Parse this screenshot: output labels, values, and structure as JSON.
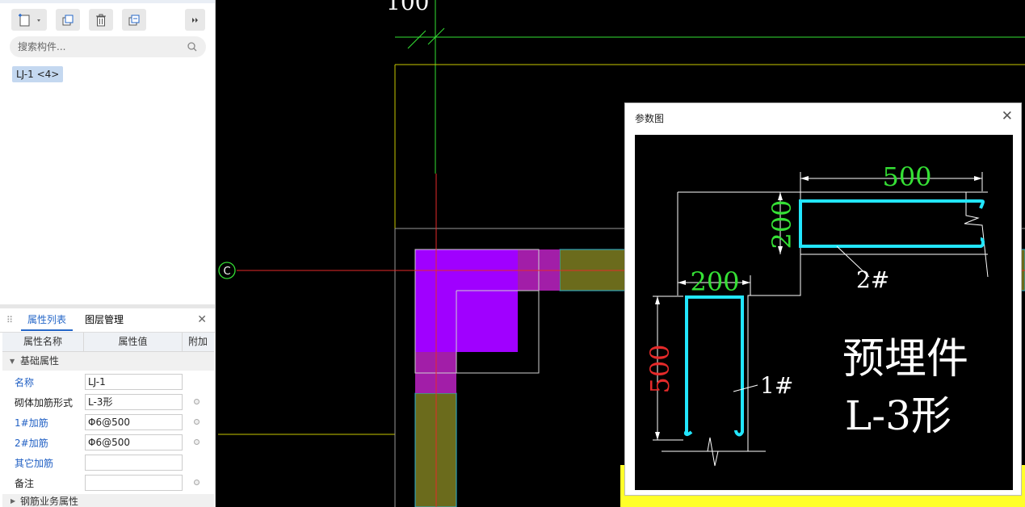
{
  "toolbar": {
    "buttons": [
      "new-component-icon",
      "copy-icon",
      "delete-icon",
      "duplicate-icon",
      "more-icon"
    ]
  },
  "search": {
    "placeholder": "搜索构件..."
  },
  "component_item": "LJ-1 <4>",
  "properties_panel": {
    "tabs": [
      "属性列表",
      "图层管理"
    ],
    "headers": [
      "属性名称",
      "属性值",
      "附加"
    ],
    "group": "基础属性",
    "rows": [
      {
        "name": "名称",
        "value": "LJ-1"
      },
      {
        "name": "砌体加筋形式",
        "value": "L-3形"
      },
      {
        "name": "1#加筋",
        "value": "Φ6@500"
      },
      {
        "name": "2#加筋",
        "value": "Φ6@500"
      },
      {
        "name": "其它加筋",
        "value": ""
      },
      {
        "name": "备注",
        "value": ""
      }
    ],
    "group2": "钢筋业务属性"
  },
  "canvas": {
    "axis_label": "C",
    "top_text": "100"
  },
  "dialog": {
    "title": "参数图",
    "diagram": {
      "dim_top": "500",
      "dim_left_vertical": "200",
      "dim_middle": "200",
      "dim_bottom_vertical": "500",
      "label_2": "2#",
      "label_1": "1#",
      "caption_line1": "预埋件",
      "caption_line2": "L-3形"
    }
  },
  "colors": {
    "accent": "#2567c8",
    "cad_bg": "#000000",
    "wall_olive": "#6b6b1c",
    "column_purple": "#a000ff",
    "rebar_cyan": "#22e6ff",
    "dim_green": "#35e035",
    "dim_red": "#e52a2a"
  }
}
